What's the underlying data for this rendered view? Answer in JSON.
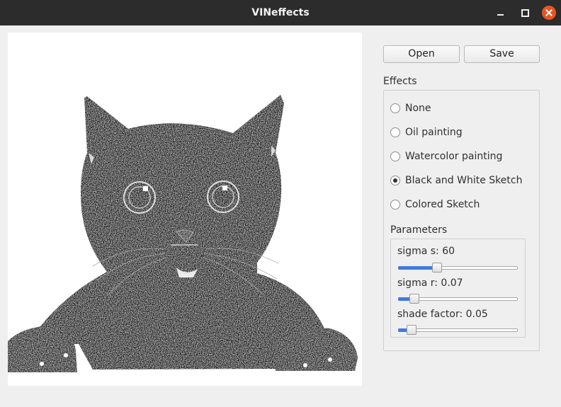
{
  "window": {
    "title": "VINeffects"
  },
  "toolbar": {
    "open_label": "Open",
    "save_label": "Save"
  },
  "effects": {
    "title": "Effects",
    "options": [
      {
        "label": "None",
        "checked": false
      },
      {
        "label": "Oil painting",
        "checked": false
      },
      {
        "label": "Watercolor painting",
        "checked": false
      },
      {
        "label": "Black and White Sketch",
        "checked": true
      },
      {
        "label": "Colored Sketch",
        "checked": false
      }
    ]
  },
  "parameters": {
    "title": "Parameters",
    "sliders": [
      {
        "label": "sigma s: 60",
        "value": 0.31
      },
      {
        "label": "sigma r: 0.07",
        "value": 0.1
      },
      {
        "label": "shade factor: 0.05",
        "value": 0.08
      }
    ]
  },
  "image": {
    "subject": "black and white sketch of a black kitten with paws over the edge"
  }
}
